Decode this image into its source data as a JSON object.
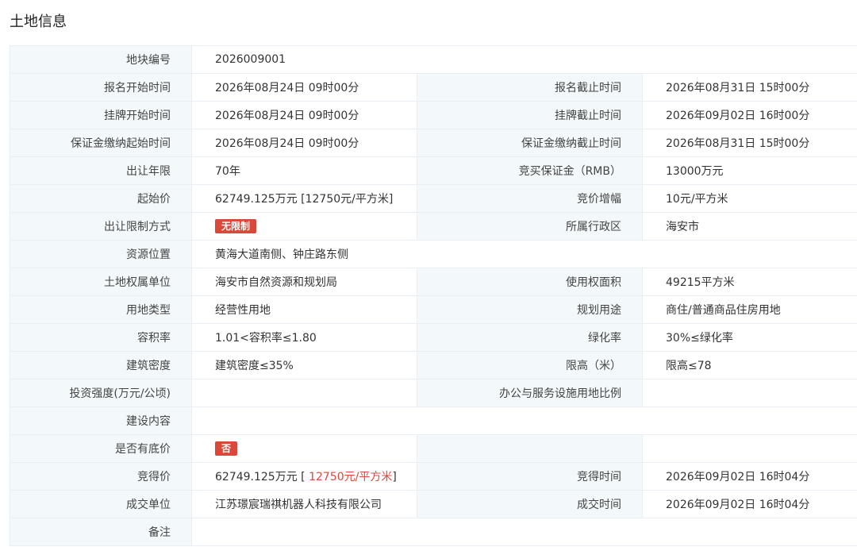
{
  "page_title": "土地信息",
  "rows": {
    "r1": {
      "l1": "地块编号",
      "v1": "2026009001"
    },
    "r2": {
      "l1": "报名开始时间",
      "v1": "2026年08月24日 09时00分",
      "l2": "报名截止时间",
      "v2": "2026年08月31日 15时00分"
    },
    "r3": {
      "l1": "挂牌开始时间",
      "v1": "2026年08月24日 09时00分",
      "l2": "挂牌截止时间",
      "v2": "2026年09月02日 16时00分"
    },
    "r4": {
      "l1": "保证金缴纳起始时间",
      "v1": "2026年08月24日 09时00分",
      "l2": "保证金缴纳截止时间",
      "v2": "2026年08月31日 15时00分"
    },
    "r5": {
      "l1": "出让年限",
      "v1": "70年",
      "l2": "竞买保证金（RMB）",
      "v2": "13000万元"
    },
    "r6": {
      "l1": "起始价",
      "v1": "62749.125万元 [12750元/平方米]",
      "l2": "竞价增幅",
      "v2": "10元/平方米"
    },
    "r7": {
      "l1": "出让限制方式",
      "badge": "无限制",
      "l2": "所属行政区",
      "v2": "海安市"
    },
    "r8": {
      "l1": "资源位置",
      "v1": "黄海大道南侧、钟庄路东侧"
    },
    "r9": {
      "l1": "土地权属单位",
      "v1": "海安市自然资源和规划局",
      "l2": "使用权面积",
      "v2": "49215平方米"
    },
    "r10": {
      "l1": "用地类型",
      "v1": "经营性用地",
      "l2": "规划用途",
      "v2": "商住/普通商品住房用地"
    },
    "r11": {
      "l1": "容积率",
      "v1": "1.01<容积率≤1.80",
      "l2": "绿化率",
      "v2": "30%≤绿化率"
    },
    "r12": {
      "l1": "建筑密度",
      "v1": "建筑密度≤35%",
      "l2": "限高（米）",
      "v2": "限高≤78"
    },
    "r13": {
      "l1": "投资强度(万元/公顷)",
      "v1": "",
      "l2": "办公与服务设施用地比例",
      "v2": ""
    },
    "r14": {
      "l1": "建设内容",
      "v1": ""
    },
    "r15": {
      "l1": "是否有底价",
      "badge": "否",
      "l2": "",
      "v2": ""
    },
    "r16": {
      "l1": "竞得价",
      "v1_prefix": "62749.125万元 [ ",
      "v1_red": "12750元/平方米",
      "v1_suffix": "]",
      "l2": "竞得时间",
      "v2": "2026年09月02日 16时04分"
    },
    "r17": {
      "l1": "成交单位",
      "v1": "江苏璟宸瑞祺机器人科技有限公司",
      "l2": "成交时间",
      "v2": "2026年09月02日 16时04分"
    },
    "r18": {
      "l1": "备注",
      "v1": ""
    }
  },
  "colors": {
    "label_bg": "#f3f8fb",
    "border": "#e8eef3",
    "badge_red": "#d9483b"
  }
}
